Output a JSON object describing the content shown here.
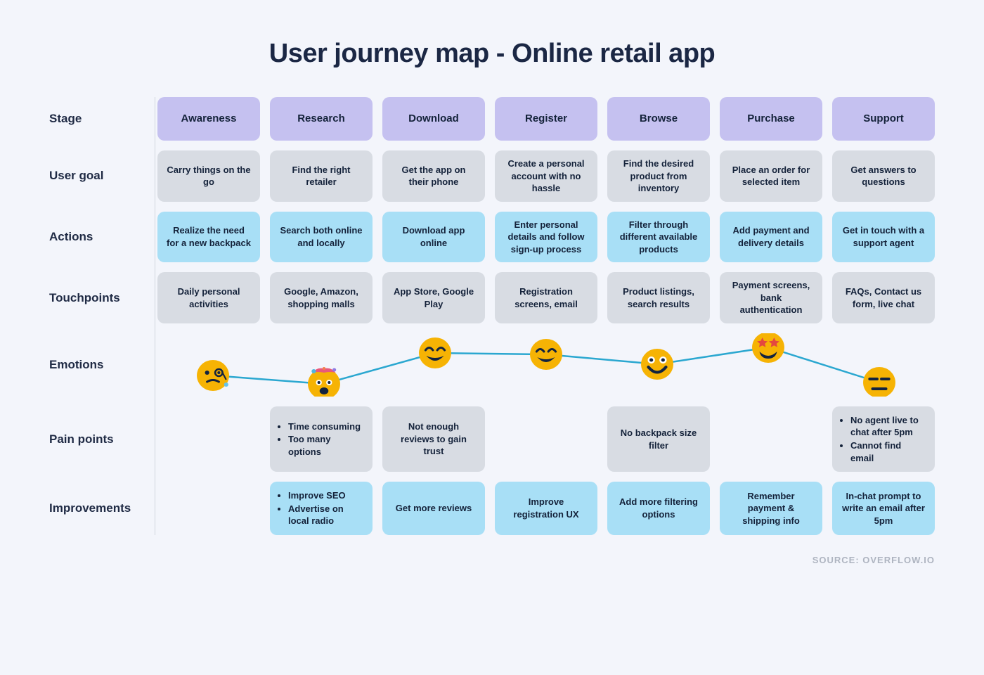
{
  "title": "User journey map - Online retail app",
  "source_label": "SOURCE: OVERFLOW.IO",
  "row_labels": {
    "stage": "Stage",
    "user_goal": "User goal",
    "actions": "Actions",
    "touchpoints": "Touchpoints",
    "emotions": "Emotions",
    "pain_points": "Pain points",
    "improvements": "Improvements"
  },
  "stages": [
    {
      "name": "Awareness",
      "user_goal": "Carry things on the go",
      "actions": "Realize the need for a new backpack",
      "touchpoints": "Daily personal activities",
      "emotion": {
        "face": "confused",
        "y": 60
      },
      "pain_points": null,
      "improvements": null
    },
    {
      "name": "Research",
      "user_goal": "Find the right retailer",
      "actions": "Search both online and locally",
      "touchpoints": "Google, Amazon, shopping malls",
      "emotion": {
        "face": "overwhelmed",
        "y": 72
      },
      "pain_points": [
        "Time consuming",
        "Too many options"
      ],
      "improvements": [
        "Improve SEO",
        "Advertise on local radio"
      ]
    },
    {
      "name": "Download",
      "user_goal": "Get the app on their phone",
      "actions": "Download app online",
      "touchpoints": "App Store, Google Play",
      "emotion": {
        "face": "happy",
        "y": 28
      },
      "pain_points": "Not enough reviews to gain trust",
      "improvements": "Get more reviews"
    },
    {
      "name": "Register",
      "user_goal": "Create a personal account with no hassle",
      "actions": "Enter personal details and follow sign-up process",
      "touchpoints": "Registration screens, email",
      "emotion": {
        "face": "happy",
        "y": 30
      },
      "pain_points": null,
      "improvements": "Improve registration UX"
    },
    {
      "name": "Browse",
      "user_goal": "Find the desired product from inventory",
      "actions": "Filter through different available products",
      "touchpoints": "Product listings, search results",
      "emotion": {
        "face": "smile",
        "y": 44
      },
      "pain_points": "No backpack size filter",
      "improvements": "Add more filtering options"
    },
    {
      "name": "Purchase",
      "user_goal": "Place an order for selected item",
      "actions": "Add payment and delivery details",
      "touchpoints": "Payment screens, bank authentication",
      "emotion": {
        "face": "star-eyes",
        "y": 20
      },
      "pain_points": null,
      "improvements": "Remember payment & shipping info"
    },
    {
      "name": "Support",
      "user_goal": "Get answers to questions",
      "actions": "Get in touch with a support agent",
      "touchpoints": "FAQs, Contact us form, live chat",
      "emotion": {
        "face": "neutral",
        "y": 70
      },
      "pain_points": [
        "No agent live to chat after 5pm",
        "Cannot find email"
      ],
      "improvements": "In-chat prompt to write an email after 5pm"
    }
  ]
}
